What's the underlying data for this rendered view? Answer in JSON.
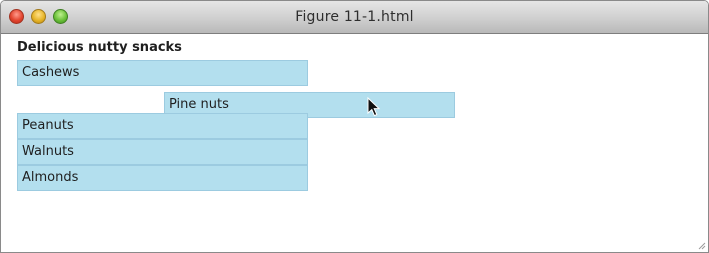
{
  "window": {
    "title": "Figure 11-1.html"
  },
  "page": {
    "heading": "Delicious nutty snacks",
    "items": [
      {
        "label": "Cashews",
        "dragging": false
      },
      {
        "label": "Pine nuts",
        "dragging": true
      },
      {
        "label": "Peanuts",
        "dragging": false
      },
      {
        "label": "Walnuts",
        "dragging": false
      },
      {
        "label": "Almonds",
        "dragging": false
      }
    ]
  },
  "colors": {
    "item_background": "#b3dfee",
    "item_border": "#9ccbe0"
  },
  "icons": {
    "close": "close-button",
    "minimize": "minimize-button",
    "maximize": "zoom-button",
    "cursor": "arrow-pointer-icon",
    "resize": "resize-grip-icon"
  }
}
